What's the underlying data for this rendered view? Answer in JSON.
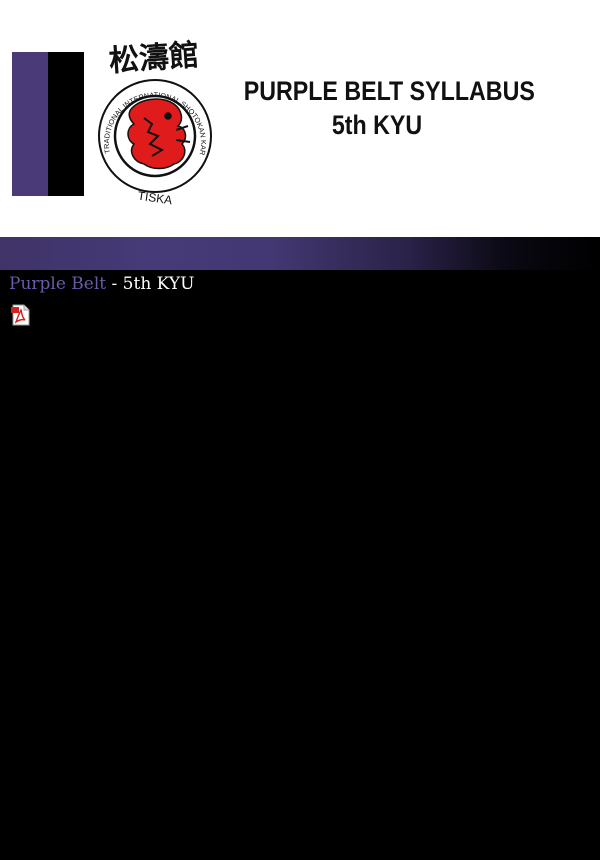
{
  "header": {
    "title_line1": "PURPLE BELT SYLLABUS",
    "title_line2": "5th KYU",
    "logo": {
      "kanji": "松濤館",
      "ring_text": "TRADITIONAL INTERNATIONAL SHOTOKAN KARATE ASSOCIATION",
      "acronym": "TISKA"
    }
  },
  "content": {
    "belt_link": "Purple Belt",
    "kyu_text": " - 5th KYU",
    "pdf_icon": "pdf-file-icon"
  },
  "colors": {
    "belt_purple": "#4a3a78",
    "link_purple": "#6b5aa8",
    "background": "#000000",
    "logo_red": "#e01b1b"
  }
}
